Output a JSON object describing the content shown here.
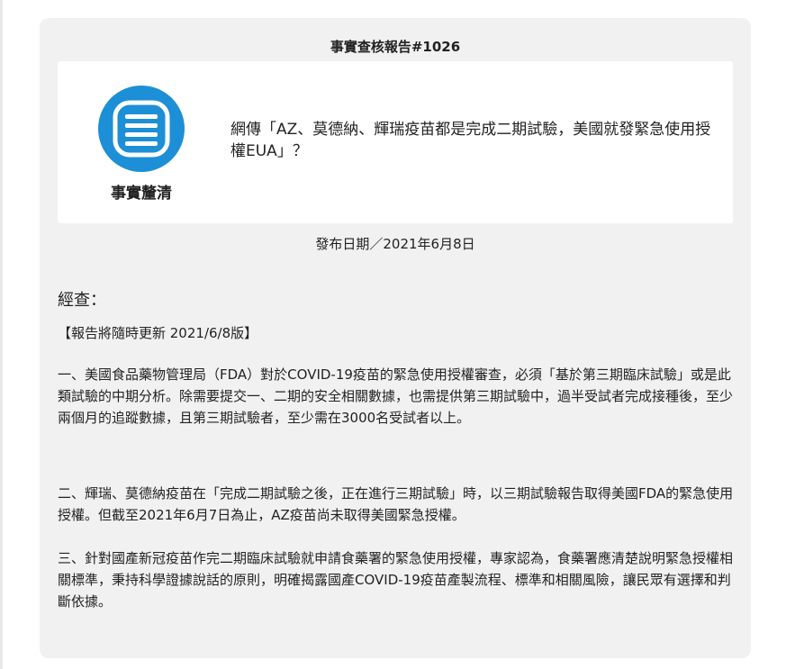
{
  "report": {
    "title": "事實查核報告#1026",
    "verdict_label": "事實釐清",
    "verdict_icon": "document-lines-icon",
    "accent_color": "#1c8fd6",
    "claim": "網傳「AZ、莫德納、輝瑞疫苗都是完成二期試驗，美國就發緊急使用授權EUA」？",
    "publish_date": "發布日期／2021年6月8日"
  },
  "body": {
    "heading": "經查：",
    "update_note": "【報告將隨時更新 2021/6/8版】",
    "paragraphs": [
      "一、美國食品藥物管理局（FDA）對於COVID-19疫苗的緊急使用授權審查，必須「基於第三期臨床試驗」或是此類試驗的中期分析。除需要提交一、二期的安全相關數據，也需提供第三期試驗中，過半受試者完成接種後，至少兩個月的追蹤數據，且第三期試驗者，至少需在3000名受試者以上。",
      "二、輝瑞、莫德納疫苗在「完成二期試驗之後，正在進行三期試驗」時，以三期試驗報告取得美國FDA的緊急使用授權。但截至2021年6月7日為止，AZ疫苗尚未取得美國緊急授權。",
      "三、針對國產新冠疫苗作完二期臨床試驗就申請食藥署的緊急使用授權，專家認為，食藥署應清楚說明緊急授權相關標準，秉持科學證據說話的原則，明確揭露國產COVID-19疫苗產製流程、標準和相關風險，讓民眾有選擇和判斷依據。"
    ]
  }
}
